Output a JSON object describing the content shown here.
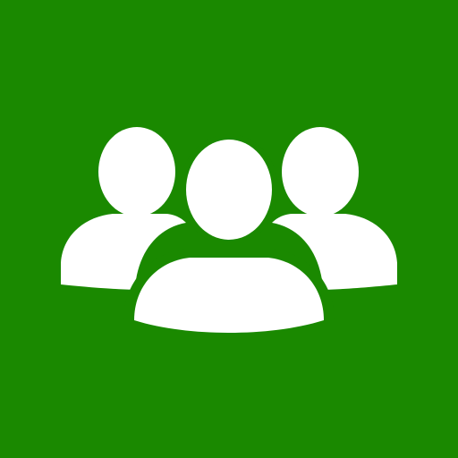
{
  "app_tile": {
    "icon": "people-group-icon",
    "background_color": "#1a8900",
    "icon_color": "#ffffff"
  }
}
